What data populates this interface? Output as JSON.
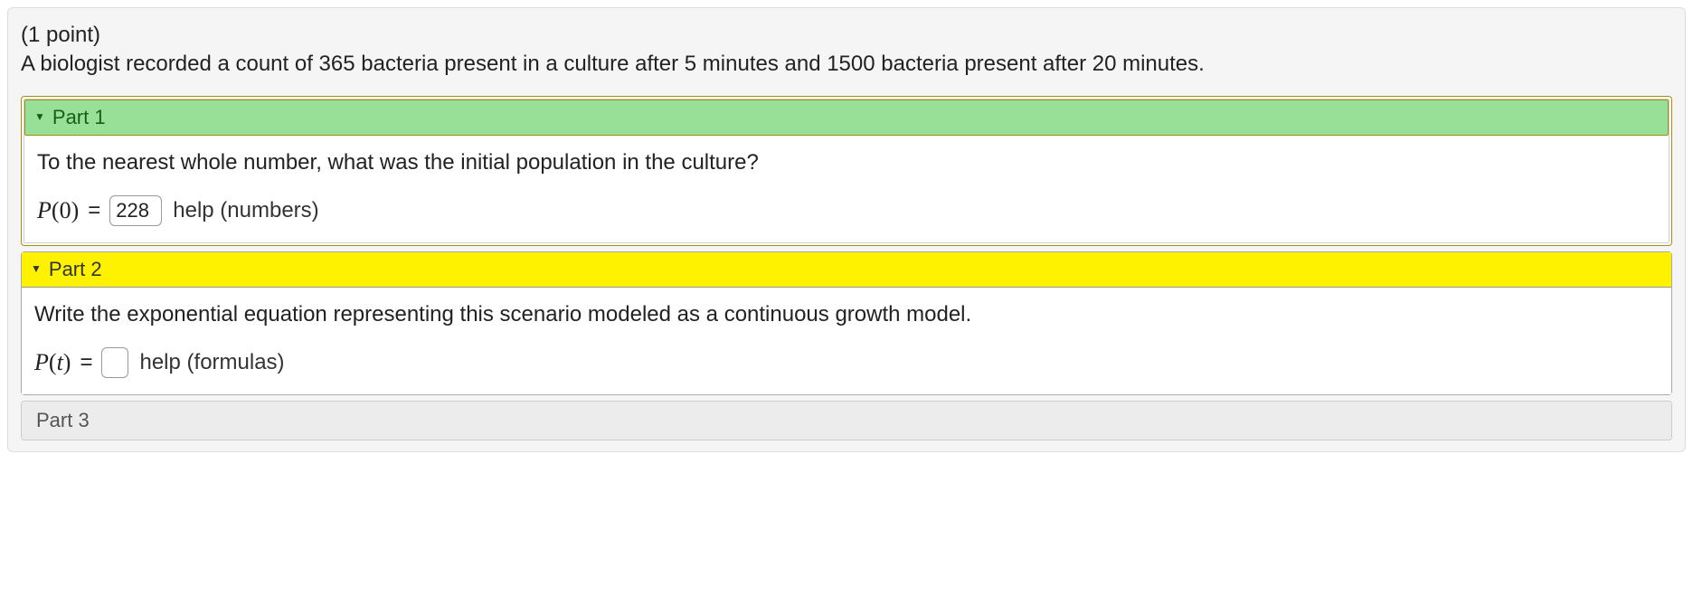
{
  "problem": {
    "points_label": "(1 point)",
    "prompt": "A biologist recorded a count of 365 bacteria present in a culture after 5 minutes and 1500 bacteria present after 20 minutes."
  },
  "part1": {
    "title": "Part 1",
    "prompt": "To the nearest whole number, what was the initial population in the culture?",
    "lhs_var": "P",
    "lhs_arg": "0",
    "answer_value": "228",
    "help_label": "help (numbers)"
  },
  "part2": {
    "title": "Part 2",
    "prompt": "Write the exponential equation representing this scenario modeled as a continuous growth model.",
    "lhs_var": "P",
    "lhs_arg": "t",
    "answer_value": "",
    "help_label": "help (formulas)"
  },
  "part3": {
    "title": "Part 3"
  }
}
